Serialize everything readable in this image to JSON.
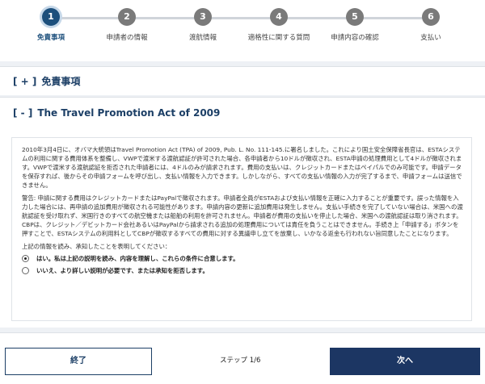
{
  "steps": [
    {
      "number": "1",
      "label": "免責事項"
    },
    {
      "number": "2",
      "label": "申請者の情報"
    },
    {
      "number": "3",
      "label": "渡航情報"
    },
    {
      "number": "4",
      "label": "適格性に関する質問"
    },
    {
      "number": "5",
      "label": "申請内容の確認"
    },
    {
      "number": "6",
      "label": "支払い"
    }
  ],
  "active_step": 1,
  "sections": {
    "disclaimer": {
      "toggle": "[ + ]",
      "title": "免責事項"
    },
    "travel_act": {
      "toggle": "[ - ]",
      "title": "The Travel Promotion Act of 2009"
    }
  },
  "content": {
    "paragraph1": "2010年3月4日に、オバマ大統領はTravel Promotion Act (TPA) of 2009, Pub. L. No. 111-145.に署名しました。これにより国土安全保障省長官は、ESTAシステムの利用に関する費用体系を整備し、VWPで渡米する渡航認証が許可された場合、各申請者から10ドルが徴収され、ESTA申請の処理費用として4ドルが徴収されます。VWPで渡米する渡航認証を拒否された申請者には、4ドルのみが請求されます。費用の支払いは、クレジットカードまたはペイパルでのみ可能です。申請データを保存すれば、後からその申請フォームを呼び出し、支払い情報を入力できます。しかしながら、すべての支払い情報の入力が完了するまで、申請フォームは送信できません。",
    "paragraph2": "警告: 申請に関する費用はクレジットカードまたはPayPalで徴収されます。申請者全員がESTAおよび支払い情報を正確に入力することが重要です。誤った情報を入力した場合には、再申請の追加費用が徴収される可能性があります。申請内容の更新に追加費用は発生しません。支払い手続きを完了していない場合は、米国への渡航認証を受け取れず、米国行きのすべての航空機または船舶の利用を許可されません。申請者が費用の支払いを停止した場合、米国への渡航認証は取り消されます。CBPは、クレジット／デビットカード会社あるいはPayPalから請求される追加の処理費用については責任を負うことはできません。手続き上「申請する」ボタンを押すことで、ESTAシステムの利用料としてCBPが徴収するすべての費用に対する異議申し立てを放棄し、いかなる返金も行われない旨同意したことになります。",
    "prompt": "上記の情報を読み、承知したことを表明してください：",
    "option_yes": "はい。私は上記の説明を読み、内容を理解し、これらの条件に合意します。",
    "option_no": "いいえ、より詳しい説明が必要です、または承知を拒否します。",
    "selected": "yes"
  },
  "footer": {
    "end_label": "終了",
    "step_counter": "ステップ 1/6",
    "next_label": "次へ"
  },
  "colors": {
    "primary": "#1c3663",
    "active_step": "#1c4f7c",
    "inactive_step": "#7a7a7a"
  }
}
